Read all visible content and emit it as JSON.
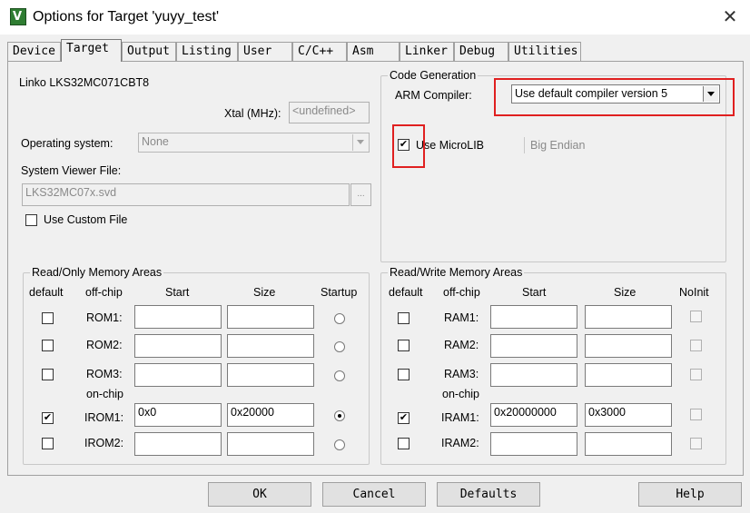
{
  "window": {
    "title": "Options for Target 'yuyy_test'",
    "close_glyph": "✕",
    "icon_glyph": "V"
  },
  "tabs": [
    "Device",
    "Target",
    "Output",
    "Listing",
    "User",
    "C/C++",
    "Asm",
    "Linker",
    "Debug",
    "Utilities"
  ],
  "active_tab": "Target",
  "target": {
    "device_name": "Linko LKS32MC071CBT8",
    "xtal_label": "Xtal (MHz):",
    "xtal_value": "<undefined>",
    "os_label": "Operating system:",
    "os_value": "None",
    "svd_label": "System Viewer File:",
    "svd_value": "LKS32MC07x.svd",
    "browse_label": "...",
    "custom_file_label": "Use Custom File",
    "custom_file_checked": false
  },
  "code_generation": {
    "legend": "Code Generation",
    "compiler_label": "ARM Compiler:",
    "compiler_value": "Use default compiler version 5",
    "microlib_label": "Use MicroLIB",
    "microlib_checked": true,
    "big_endian_label": "Big Endian"
  },
  "ro_memory": {
    "legend": "Read/Only Memory Areas",
    "headers": {
      "default": "default",
      "offchip": "off-chip",
      "start": "Start",
      "size": "Size",
      "extra": "Startup"
    },
    "onchip_label": "on-chip",
    "rows": [
      {
        "name": "ROM1:",
        "start": "",
        "size": "",
        "default": false,
        "radio": false
      },
      {
        "name": "ROM2:",
        "start": "",
        "size": "",
        "default": false,
        "radio": false
      },
      {
        "name": "ROM3:",
        "start": "",
        "size": "",
        "default": false,
        "radio": false
      },
      {
        "name": "IROM1:",
        "start": "0x0",
        "size": "0x20000",
        "default": true,
        "radio": true
      },
      {
        "name": "IROM2:",
        "start": "",
        "size": "",
        "default": false,
        "radio": false
      }
    ]
  },
  "rw_memory": {
    "legend": "Read/Write Memory Areas",
    "headers": {
      "default": "default",
      "offchip": "off-chip",
      "start": "Start",
      "size": "Size",
      "extra": "NoInit"
    },
    "onchip_label": "on-chip",
    "rows": [
      {
        "name": "RAM1:",
        "start": "",
        "size": "",
        "default": false,
        "noinit": false
      },
      {
        "name": "RAM2:",
        "start": "",
        "size": "",
        "default": false,
        "noinit": false
      },
      {
        "name": "RAM3:",
        "start": "",
        "size": "",
        "default": false,
        "noinit": false
      },
      {
        "name": "IRAM1:",
        "start": "0x20000000",
        "size": "0x3000",
        "default": true,
        "noinit": false
      },
      {
        "name": "IRAM2:",
        "start": "",
        "size": "",
        "default": false,
        "noinit": false
      }
    ]
  },
  "buttons": {
    "ok": "OK",
    "cancel": "Cancel",
    "defaults": "Defaults",
    "help": "Help"
  },
  "check_glyph": "✔",
  "colors": {
    "highlight_box": "#e02020",
    "background": "#f0f0f0"
  }
}
